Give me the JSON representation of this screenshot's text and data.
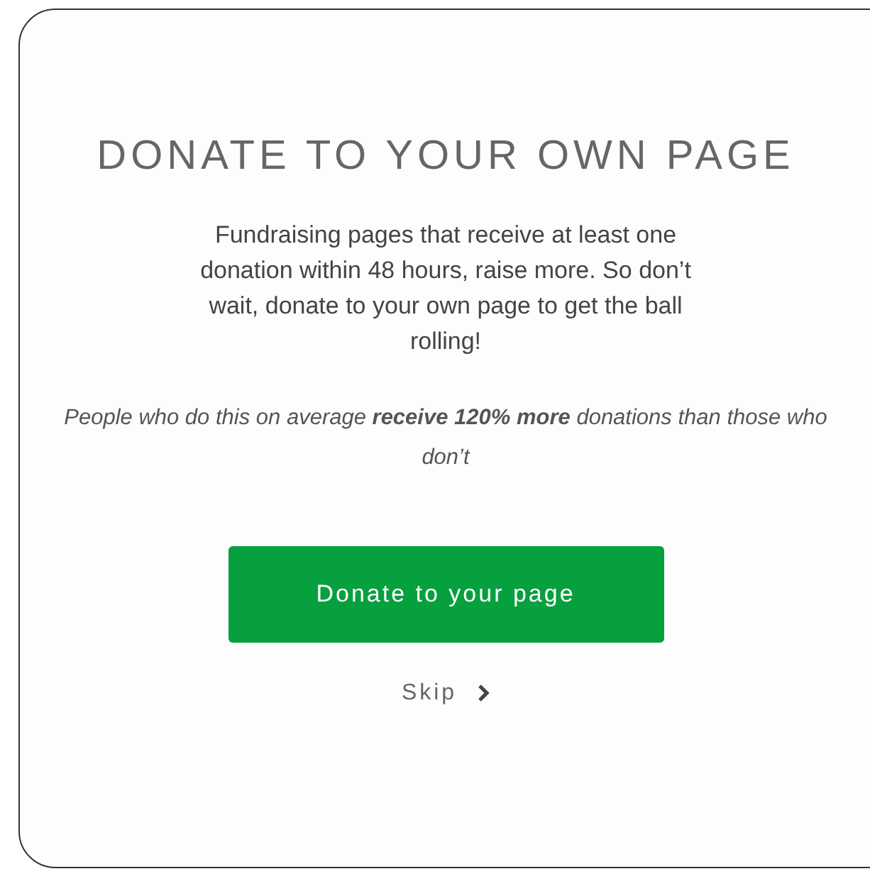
{
  "title": "DONATE TO YOUR OWN PAGE",
  "message": "Fundraising pages that receive at least one donation within 48 hours, raise more. So don’t wait, donate to your own page to get the ball rolling!",
  "note": "People who do this on average **receive 120% more** donations than those who don’t",
  "primary_button": "Donate to your page",
  "skip_link": "Skip"
}
